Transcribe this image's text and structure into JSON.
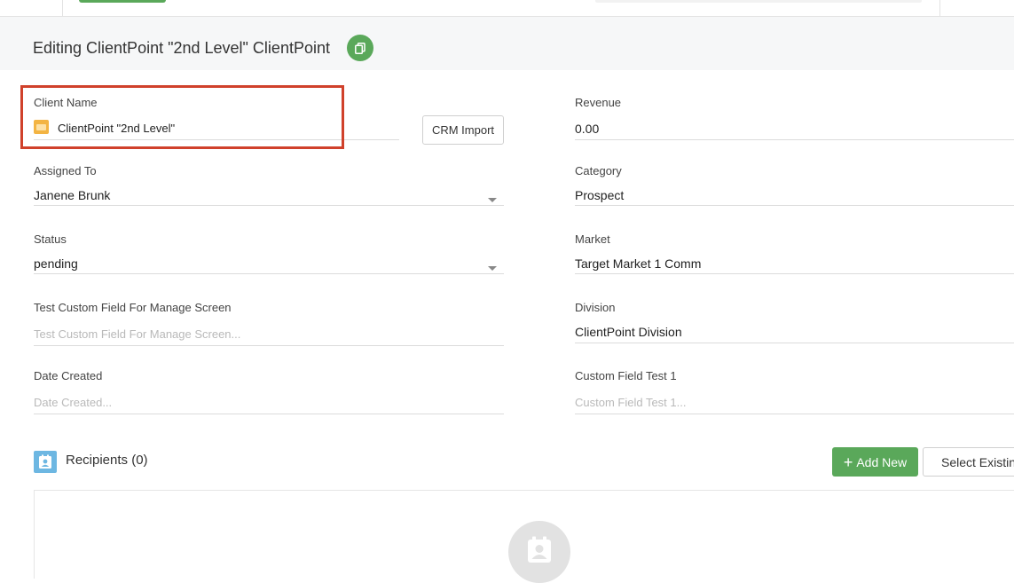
{
  "header": {
    "title": "Editing ClientPoint \"2nd Level\" ClientPoint"
  },
  "left_fields": {
    "client_name": {
      "label": "Client Name",
      "value": "ClientPoint \"2nd Level\""
    },
    "crm_import_label": "CRM Import",
    "assigned_to": {
      "label": "Assigned To",
      "value": "Janene Brunk"
    },
    "status": {
      "label": "Status",
      "value": "pending"
    },
    "test_custom_field": {
      "label": "Test Custom Field For Manage Screen",
      "placeholder": "Test Custom Field For Manage Screen..."
    },
    "date_created": {
      "label": "Date Created",
      "placeholder": "Date Created..."
    }
  },
  "right_fields": {
    "revenue": {
      "label": "Revenue",
      "value": "0.00"
    },
    "category": {
      "label": "Category",
      "value": "Prospect"
    },
    "market": {
      "label": "Market",
      "value": "Target Market 1 Comm"
    },
    "division": {
      "label": "Division",
      "value": "ClientPoint Division"
    },
    "custom_field_test_1": {
      "label": "Custom Field Test 1",
      "placeholder": "Custom Field Test 1..."
    }
  },
  "recipients": {
    "title": "Recipients (0)",
    "add_new_label": "Add New",
    "select_existing_label": "Select Existing"
  },
  "colors": {
    "accent_green": "#5aa85a",
    "highlight_red": "#d0412b",
    "recipients_icon_blue": "#6db7e2",
    "folder_icon_orange": "#f3b443"
  },
  "icons": {
    "copy": "copy-icon",
    "folder": "folder-icon",
    "recipients": "contact-card-icon",
    "empty_state": "contact-card-icon",
    "dropdown": "caret-down-icon"
  }
}
